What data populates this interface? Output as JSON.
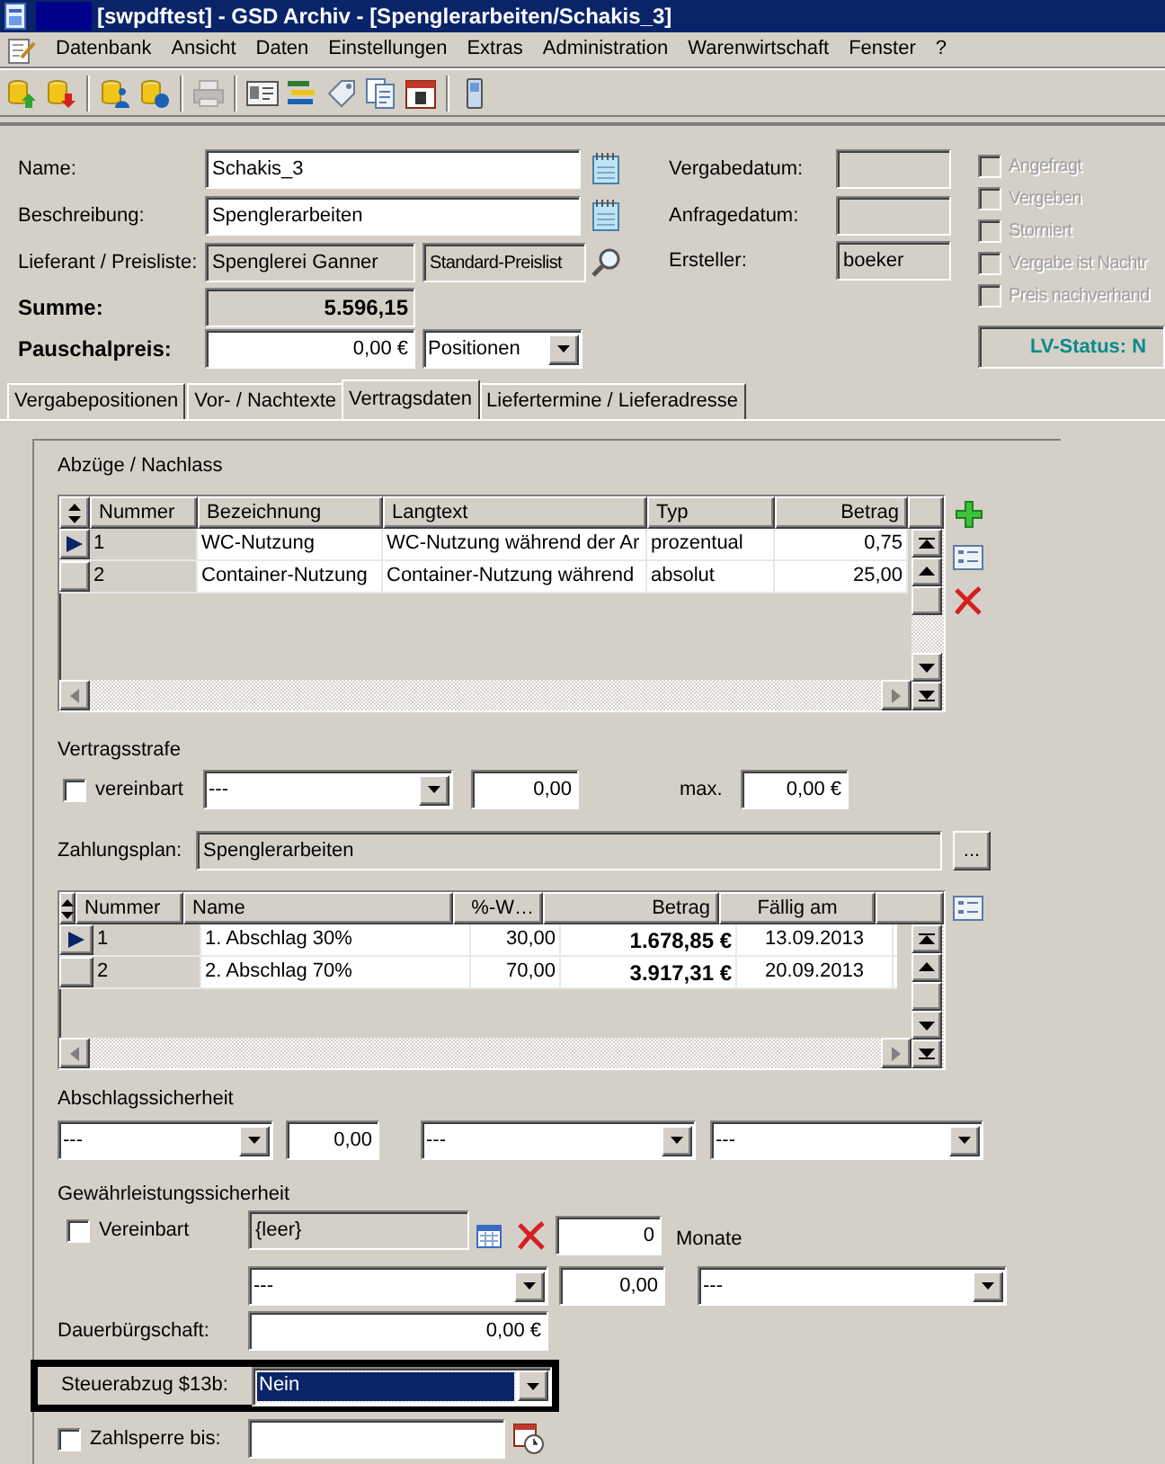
{
  "window": {
    "title": "[swpdftest] - GSD Archiv - [Spenglerarbeiten/Schakis_3]"
  },
  "menu": [
    "Datenbank",
    "Ansicht",
    "Daten",
    "Einstellungen",
    "Extras",
    "Administration",
    "Warenwirtschaft",
    "Fenster",
    "?"
  ],
  "header": {
    "name": {
      "label": "Name:",
      "value": "Schakis_3"
    },
    "beschreibung": {
      "label": "Beschreibung:",
      "value": "Spenglerarbeiten"
    },
    "lieferant": {
      "label": "Lieferant / Preisliste:",
      "value": "Spenglerei Ganner",
      "preisliste": "Standard-Preislist"
    },
    "summe": {
      "label": "Summe:",
      "value": "5.596,15"
    },
    "pauschalpreis": {
      "label": "Pauschalpreis:",
      "value": "0,00 €",
      "mode": "Positionen"
    },
    "vergabedatum": {
      "label": "Vergabedatum:"
    },
    "anfragedatum": {
      "label": "Anfragedatum:"
    },
    "ersteller": {
      "label": "Ersteller:",
      "value": "boeker"
    }
  },
  "flags": [
    {
      "label": "Angefragt",
      "checked": false,
      "disabled": true
    },
    {
      "label": "Vergeben",
      "checked": false,
      "disabled": true
    },
    {
      "label": "Storniert",
      "checked": false,
      "disabled": true
    },
    {
      "label": "Vergabe ist Nachtr",
      "checked": false,
      "disabled": true
    },
    {
      "label": "Preis nachverhand",
      "checked": false,
      "disabled": true
    }
  ],
  "lv_status": "LV-Status: N",
  "tabs": [
    {
      "label": "Vergabepositionen",
      "selected": false
    },
    {
      "label": "Vor- / Nachtexte",
      "selected": false
    },
    {
      "label": "Vertragsdaten",
      "selected": true
    },
    {
      "label": "Liefertermine / Lieferadresse",
      "selected": false
    }
  ],
  "abzuege": {
    "title": "Abzüge / Nachlass",
    "columns": [
      "Nummer",
      "Bezeichnung",
      "Langtext",
      "Typ",
      "Betrag"
    ],
    "rows": [
      {
        "selected": true,
        "cells": [
          "1",
          "WC-Nutzung",
          "WC-Nutzung während der Ar",
          "prozentual",
          "0,75"
        ]
      },
      {
        "selected": false,
        "cells": [
          "2",
          "Container-Nutzung",
          "Container-Nutzung während",
          "absolut",
          "25,00"
        ]
      }
    ]
  },
  "vertragsstrafe": {
    "title": "Vertragsstrafe",
    "vereinbart": {
      "label": "vereinbart",
      "checked": false
    },
    "type": "---",
    "value": "0,00",
    "max_label": "max.",
    "max": "0,00 €"
  },
  "zahlungsplan": {
    "label": "Zahlungsplan:",
    "value": "Spenglerarbeiten",
    "button": "...",
    "columns": [
      "Nummer",
      "Name",
      "%-W…",
      "Betrag",
      "Fällig am"
    ],
    "rows": [
      {
        "selected": true,
        "cells": [
          "1",
          "1. Abschlag 30%",
          "30,00",
          "1.678,85 €",
          "13.09.2013"
        ]
      },
      {
        "selected": false,
        "cells": [
          "2",
          "2. Abschlag 70%",
          "70,00",
          "3.917,31 €",
          "20.09.2013"
        ]
      }
    ]
  },
  "abschlagssicherheit": {
    "title": "Abschlagssicherheit",
    "type": "---",
    "value": "0,00",
    "option_2": "---",
    "option_3": "---"
  },
  "gewaehrleistung": {
    "title": "Gewährleistungssicherheit",
    "vereinbart": {
      "label": "Vereinbart",
      "checked": false
    },
    "document": "{leer}",
    "months": "0",
    "months_label": "Monate",
    "type": "---",
    "value": "0,00",
    "option_2": "---"
  },
  "dauerbuergschaft": {
    "label": "Dauerbürgschaft:",
    "value": "0,00 €"
  },
  "steuerabzug": {
    "label": "Steuerabzug $13b:",
    "value": "Nein",
    "focused": true
  },
  "zahlsperre": {
    "label": "Zahlsperre bis:",
    "checked": false
  }
}
